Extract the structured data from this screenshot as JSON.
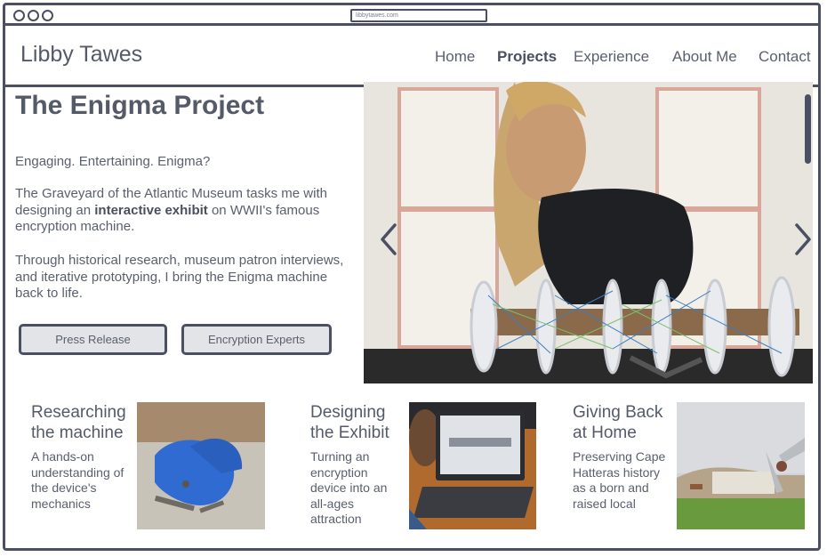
{
  "browser": {
    "url": "libbytawes.com"
  },
  "header": {
    "brand": "Libby Tawes",
    "nav": [
      "Home",
      "Projects",
      "Experience",
      "About Me",
      "Contact"
    ],
    "active": "Projects"
  },
  "intro": {
    "title": "The Enigma Project",
    "tagline": "Engaging. Entertaining. Enigma?",
    "p1_before": "The Graveyard of the Atlantic Museum tasks me with designing an ",
    "p1_bold": "interactive exhibit",
    "p1_after": " on WWII's famous encryption machine.",
    "p2": "Through historical research, museum patron interviews, and iterative prototyping, I bring the Enigma machine back to life.",
    "buttons": [
      "Press Release",
      "Encryption Experts"
    ]
  },
  "carousel": {
    "prev_icon": "chevron-left-icon",
    "next_icon": "chevron-right-icon"
  },
  "cards": [
    {
      "title": "Researching the machine",
      "text": "A hands-on understanding of the device's mechanics"
    },
    {
      "title": "Designing the Exhibit",
      "text": "Turning an encryption device into an all-ages attraction"
    },
    {
      "title": "Giving Back at Home",
      "text": "Preserving Cape Hatteras history as a born and raised local"
    }
  ],
  "colors": {
    "ink": "#4a5062",
    "text": "#5a5f6e",
    "button_fill": "#e3e4e8"
  }
}
